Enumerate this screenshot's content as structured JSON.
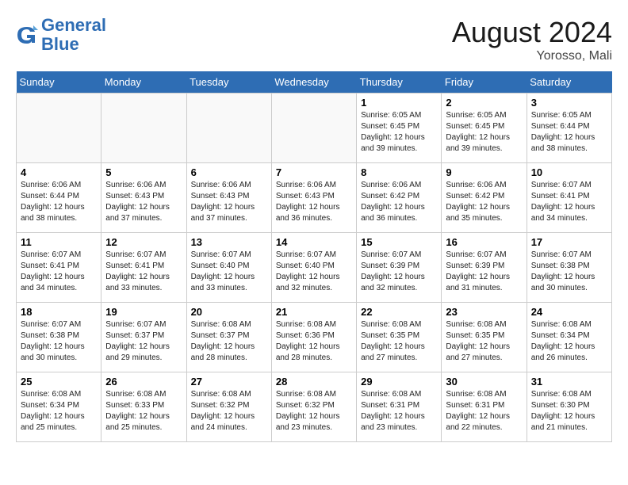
{
  "header": {
    "logo_line1": "General",
    "logo_line2": "Blue",
    "month_year": "August 2024",
    "location": "Yorosso, Mali"
  },
  "weekdays": [
    "Sunday",
    "Monday",
    "Tuesday",
    "Wednesday",
    "Thursday",
    "Friday",
    "Saturday"
  ],
  "weeks": [
    [
      {
        "day": "",
        "info": ""
      },
      {
        "day": "",
        "info": ""
      },
      {
        "day": "",
        "info": ""
      },
      {
        "day": "",
        "info": ""
      },
      {
        "day": "1",
        "info": "Sunrise: 6:05 AM\nSunset: 6:45 PM\nDaylight: 12 hours\nand 39 minutes."
      },
      {
        "day": "2",
        "info": "Sunrise: 6:05 AM\nSunset: 6:45 PM\nDaylight: 12 hours\nand 39 minutes."
      },
      {
        "day": "3",
        "info": "Sunrise: 6:05 AM\nSunset: 6:44 PM\nDaylight: 12 hours\nand 38 minutes."
      }
    ],
    [
      {
        "day": "4",
        "info": "Sunrise: 6:06 AM\nSunset: 6:44 PM\nDaylight: 12 hours\nand 38 minutes."
      },
      {
        "day": "5",
        "info": "Sunrise: 6:06 AM\nSunset: 6:43 PM\nDaylight: 12 hours\nand 37 minutes."
      },
      {
        "day": "6",
        "info": "Sunrise: 6:06 AM\nSunset: 6:43 PM\nDaylight: 12 hours\nand 37 minutes."
      },
      {
        "day": "7",
        "info": "Sunrise: 6:06 AM\nSunset: 6:43 PM\nDaylight: 12 hours\nand 36 minutes."
      },
      {
        "day": "8",
        "info": "Sunrise: 6:06 AM\nSunset: 6:42 PM\nDaylight: 12 hours\nand 36 minutes."
      },
      {
        "day": "9",
        "info": "Sunrise: 6:06 AM\nSunset: 6:42 PM\nDaylight: 12 hours\nand 35 minutes."
      },
      {
        "day": "10",
        "info": "Sunrise: 6:07 AM\nSunset: 6:41 PM\nDaylight: 12 hours\nand 34 minutes."
      }
    ],
    [
      {
        "day": "11",
        "info": "Sunrise: 6:07 AM\nSunset: 6:41 PM\nDaylight: 12 hours\nand 34 minutes."
      },
      {
        "day": "12",
        "info": "Sunrise: 6:07 AM\nSunset: 6:41 PM\nDaylight: 12 hours\nand 33 minutes."
      },
      {
        "day": "13",
        "info": "Sunrise: 6:07 AM\nSunset: 6:40 PM\nDaylight: 12 hours\nand 33 minutes."
      },
      {
        "day": "14",
        "info": "Sunrise: 6:07 AM\nSunset: 6:40 PM\nDaylight: 12 hours\nand 32 minutes."
      },
      {
        "day": "15",
        "info": "Sunrise: 6:07 AM\nSunset: 6:39 PM\nDaylight: 12 hours\nand 32 minutes."
      },
      {
        "day": "16",
        "info": "Sunrise: 6:07 AM\nSunset: 6:39 PM\nDaylight: 12 hours\nand 31 minutes."
      },
      {
        "day": "17",
        "info": "Sunrise: 6:07 AM\nSunset: 6:38 PM\nDaylight: 12 hours\nand 30 minutes."
      }
    ],
    [
      {
        "day": "18",
        "info": "Sunrise: 6:07 AM\nSunset: 6:38 PM\nDaylight: 12 hours\nand 30 minutes."
      },
      {
        "day": "19",
        "info": "Sunrise: 6:07 AM\nSunset: 6:37 PM\nDaylight: 12 hours\nand 29 minutes."
      },
      {
        "day": "20",
        "info": "Sunrise: 6:08 AM\nSunset: 6:37 PM\nDaylight: 12 hours\nand 28 minutes."
      },
      {
        "day": "21",
        "info": "Sunrise: 6:08 AM\nSunset: 6:36 PM\nDaylight: 12 hours\nand 28 minutes."
      },
      {
        "day": "22",
        "info": "Sunrise: 6:08 AM\nSunset: 6:35 PM\nDaylight: 12 hours\nand 27 minutes."
      },
      {
        "day": "23",
        "info": "Sunrise: 6:08 AM\nSunset: 6:35 PM\nDaylight: 12 hours\nand 27 minutes."
      },
      {
        "day": "24",
        "info": "Sunrise: 6:08 AM\nSunset: 6:34 PM\nDaylight: 12 hours\nand 26 minutes."
      }
    ],
    [
      {
        "day": "25",
        "info": "Sunrise: 6:08 AM\nSunset: 6:34 PM\nDaylight: 12 hours\nand 25 minutes."
      },
      {
        "day": "26",
        "info": "Sunrise: 6:08 AM\nSunset: 6:33 PM\nDaylight: 12 hours\nand 25 minutes."
      },
      {
        "day": "27",
        "info": "Sunrise: 6:08 AM\nSunset: 6:32 PM\nDaylight: 12 hours\nand 24 minutes."
      },
      {
        "day": "28",
        "info": "Sunrise: 6:08 AM\nSunset: 6:32 PM\nDaylight: 12 hours\nand 23 minutes."
      },
      {
        "day": "29",
        "info": "Sunrise: 6:08 AM\nSunset: 6:31 PM\nDaylight: 12 hours\nand 23 minutes."
      },
      {
        "day": "30",
        "info": "Sunrise: 6:08 AM\nSunset: 6:31 PM\nDaylight: 12 hours\nand 22 minutes."
      },
      {
        "day": "31",
        "info": "Sunrise: 6:08 AM\nSunset: 6:30 PM\nDaylight: 12 hours\nand 21 minutes."
      }
    ]
  ]
}
